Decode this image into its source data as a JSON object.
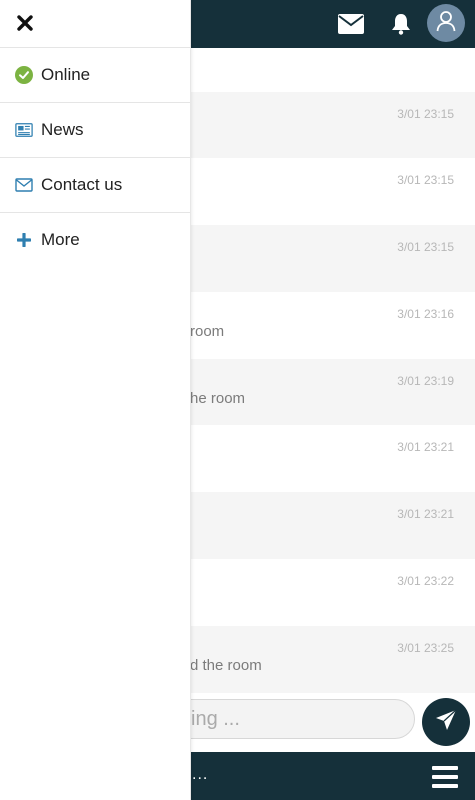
{
  "colors": {
    "bar": "#15303a",
    "accent_blue": "#2f7fb0",
    "online_green": "#7cb342",
    "avatar": "#6e8aa3"
  },
  "header": {
    "mail_icon": "mail-icon",
    "bell_icon": "bell-icon",
    "avatar_icon": "user-icon"
  },
  "messages": [
    {
      "time": "3/01 23:15",
      "text": ""
    },
    {
      "time": "3/01 23:15",
      "text": ""
    },
    {
      "time": "3/01 23:15",
      "text": ""
    },
    {
      "time": "3/01 23:16",
      "text": "room"
    },
    {
      "time": "3/01 23:19",
      "text": "he room"
    },
    {
      "time": "3/01 23:21",
      "text": ""
    },
    {
      "time": "3/01 23:21",
      "text": ""
    },
    {
      "time": "3/01 23:22",
      "text": ""
    },
    {
      "time": "3/01 23:25",
      "text": "d the room"
    }
  ],
  "composer": {
    "placeholder": "ing ..."
  },
  "bottom": {
    "dots": "..."
  },
  "drawer": {
    "items": [
      {
        "label": "Online",
        "icon": "check-circle-icon"
      },
      {
        "label": "News",
        "icon": "newspaper-icon"
      },
      {
        "label": "Contact us",
        "icon": "envelope-icon"
      },
      {
        "label": "More",
        "icon": "plus-icon"
      }
    ]
  }
}
